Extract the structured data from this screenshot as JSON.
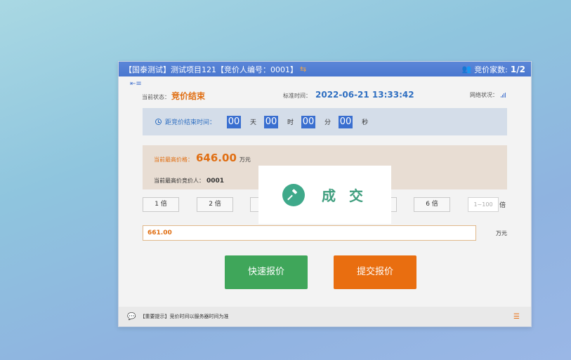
{
  "titlebar": {
    "title": "【国泰测试】测试项目121【竞价人编号：0001】",
    "swap_icon": "swap-icon",
    "bidder_count_label": "竞价家数:",
    "bidder_count": "1/2"
  },
  "status": {
    "label": "当前状态：",
    "value": "竞价结束",
    "time_label": "标准时间：",
    "time_value": "2022-06-21 13:33:42",
    "network_label": "网络状况："
  },
  "countdown": {
    "label": "距竞价结束时间：",
    "days": "00",
    "days_unit": "天",
    "hours": "00",
    "hours_unit": "时",
    "minutes": "00",
    "minutes_unit": "分",
    "seconds": "00",
    "seconds_unit": "秒"
  },
  "price": {
    "highest_label": "当前最高价格：",
    "highest_value": "646.00",
    "highest_unit": "万元",
    "bidder_label": "当前最高价竞价人：",
    "bidder_value": "0001"
  },
  "multipliers": {
    "btn1": "1 倍",
    "btn2": "2 倍",
    "btn6": "6 倍",
    "custom_placeholder": "1~100",
    "custom_unit": "倍"
  },
  "bid": {
    "value": "661.00",
    "unit": "万元"
  },
  "buttons": {
    "quick": "快速报价",
    "submit": "提交报价"
  },
  "tip": {
    "text": "【重要提示】竞价时间以服务器时间为准"
  },
  "overlay": {
    "label": "成 交"
  },
  "colors": {
    "accent_blue": "#4a77cf",
    "orange": "#e96e10",
    "green": "#3fa65a"
  }
}
